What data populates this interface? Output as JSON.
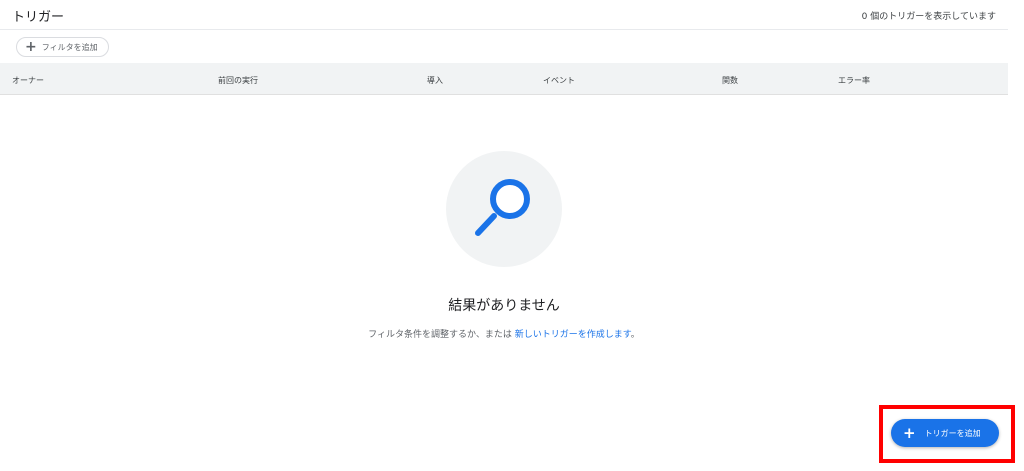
{
  "header": {
    "title": "トリガー",
    "count_text": "0 個のトリガーを表示しています"
  },
  "filter": {
    "icon": "plus-icon",
    "label": "フィルタを追加"
  },
  "table": {
    "columns": [
      "オーナー",
      "前回の実行",
      "導入",
      "イベント",
      "関数",
      "エラー率"
    ]
  },
  "empty_state": {
    "icon": "search-icon",
    "title": "結果がありません",
    "hint_prefix": "フィルタ条件を調整するか、または ",
    "hint_link": "新しいトリガーを作成します",
    "hint_suffix": "。"
  },
  "fab": {
    "icon": "plus-icon",
    "label": "トリガーを追加"
  },
  "colors": {
    "accent": "#1a73e8",
    "highlight": "#ff0000",
    "header_bg": "#f1f3f4"
  }
}
